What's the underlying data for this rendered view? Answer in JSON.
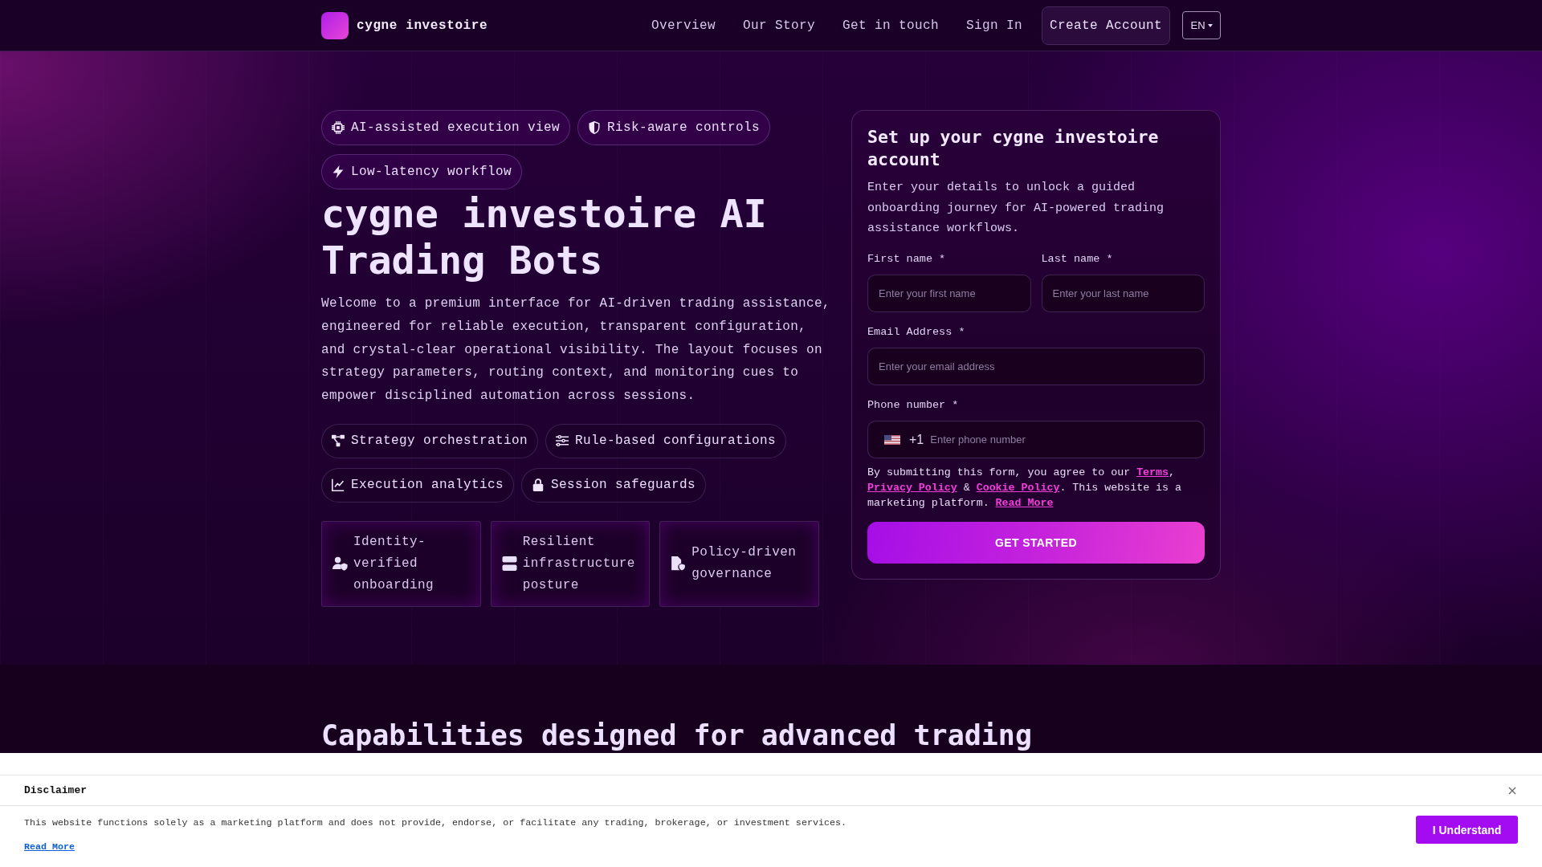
{
  "header": {
    "brand": "cygne investoire",
    "nav": [
      "Overview",
      "Our Story",
      "Get in touch",
      "Sign In"
    ],
    "cta": "Create Account",
    "language": "EN"
  },
  "hero": {
    "tags": [
      "AI-assisted execution view",
      "Risk-aware controls",
      "Low-latency workflow"
    ],
    "title": "cygne investoire AI Trading Bots",
    "description": "Welcome to a premium interface for AI-driven trading assistance, engineered for reliable execution, transparent configuration, and crystal-clear operational visibility. The layout focuses on strategy parameters, routing context, and monitoring cues to empower disciplined automation across sessions.",
    "features": [
      "Strategy orchestration",
      "Rule-based configurations",
      "Execution analytics",
      "Session safeguards"
    ],
    "cards": [
      "Identity-verified onboarding",
      "Resilient infrastructure posture",
      "Policy-driven governance"
    ]
  },
  "signup_form": {
    "title": "Set up your cygne investoire account",
    "description": "Enter your details to unlock a guided onboarding journey for AI-powered trading assistance workflows.",
    "fields": [
      {
        "kind": "text",
        "label": "First name *",
        "placeholder": "Enter your first name"
      },
      {
        "kind": "text",
        "label": "Last name *",
        "placeholder": "Enter your last name"
      },
      {
        "kind": "email",
        "label": "Email Address *",
        "placeholder": "Enter your email address"
      },
      {
        "kind": "phone",
        "label": "Phone number *",
        "dial_code": "+1",
        "placeholder": "Enter phone number"
      }
    ],
    "consent": [
      {
        "kind": "text",
        "text": "By submitting this form, you agree to our "
      },
      {
        "kind": "link",
        "text": "Terms"
      },
      {
        "kind": "text",
        "text": ", "
      },
      {
        "kind": "link",
        "text": "Privacy Policy"
      },
      {
        "kind": "text",
        "text": " & "
      },
      {
        "kind": "link",
        "text": "Cookie Policy"
      },
      {
        "kind": "text",
        "text": ". This website is a marketing platform. "
      },
      {
        "kind": "link",
        "text": "Read More"
      }
    ],
    "submit": "GET STARTED"
  },
  "capabilities": {
    "title": "Capabilities designed for advanced trading"
  },
  "disclaimer": {
    "title": "Disclaimer",
    "text": "This website functions solely as a marketing platform and does not provide, endorse, or facilitate any trading, brokerage, or investment services.",
    "link": "Read More",
    "button": "I Understand"
  }
}
